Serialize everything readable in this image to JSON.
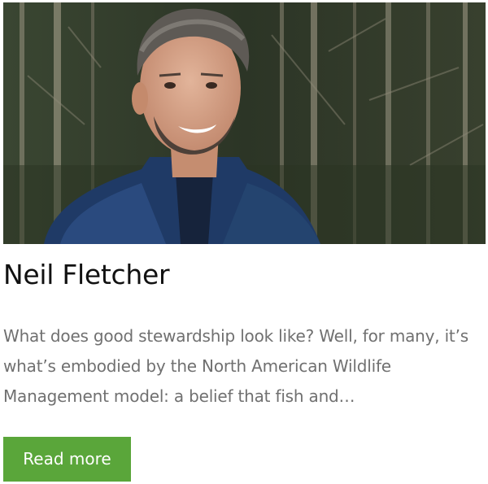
{
  "card": {
    "image_alt": "Portrait of a smiling bearded man in a blue vest in front of trees",
    "title": "Neil Fletcher",
    "excerpt": "What does good stewardship look like? Well, for many, it’s what’s embodied by the North American Wildlife Management model: a belief that fish and…",
    "button_label": "Read more"
  },
  "colors": {
    "button_bg": "#5aa63a",
    "title": "#111111",
    "excerpt": "#707070"
  }
}
